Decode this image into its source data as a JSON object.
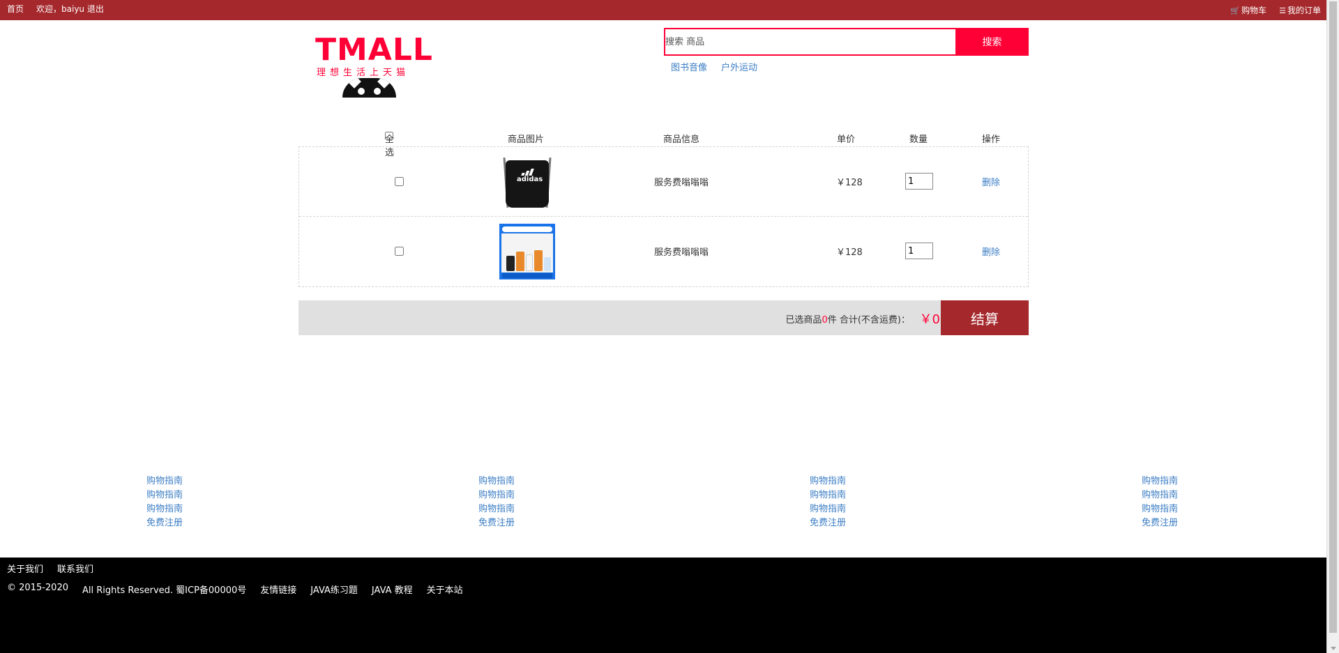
{
  "topbar": {
    "home": "首页",
    "welcome": "欢迎，baiyu",
    "logout": "退出",
    "cart": "购物车",
    "orders": "我的订单"
  },
  "logo": {
    "word": "TMALL",
    "slogan": "理想生活上天猫"
  },
  "search": {
    "placeholder": "搜索 商品",
    "button": "搜索"
  },
  "quick_links": [
    "图书音像",
    "户外运动"
  ],
  "cart": {
    "headers": {
      "select_all": "全选",
      "image": "商品图片",
      "info": "商品信息",
      "price": "单价",
      "qty": "数量",
      "action": "操作"
    },
    "items": [
      {
        "name": "服务费嗡嗡嗡",
        "price": "￥128",
        "qty": "1",
        "delete": "删除",
        "image": "adidas-bag"
      },
      {
        "name": "服务费嗡嗡嗡",
        "price": "￥128",
        "qty": "1",
        "delete": "删除",
        "image": "supplement-box"
      }
    ],
    "summary": {
      "prefix": "已选商品",
      "count": "0",
      "suffix": "件  合计(不含运费)：",
      "total": "￥0",
      "checkout": "结算"
    }
  },
  "guide": {
    "columns": [
      [
        "购物指南",
        "购物指南",
        "购物指南",
        "免费注册"
      ],
      [
        "购物指南",
        "购物指南",
        "购物指南",
        "免费注册"
      ],
      [
        "购物指南",
        "购物指南",
        "购物指南",
        "免费注册"
      ],
      [
        "购物指南",
        "购物指南",
        "购物指南",
        "免费注册"
      ]
    ]
  },
  "footer": {
    "about": "关于我们",
    "contact": "联系我们",
    "copyright": "© 2015-2020",
    "rights": "All Rights Reserved. 蜀ICP备00000号",
    "links": [
      "友情链接",
      "JAVA练习题",
      "JAVA 教程",
      "关于本站"
    ]
  },
  "colors": {
    "brand_red": "#a5282c",
    "tmall_red": "#ff0036",
    "link_blue": "#3b7dc4"
  }
}
